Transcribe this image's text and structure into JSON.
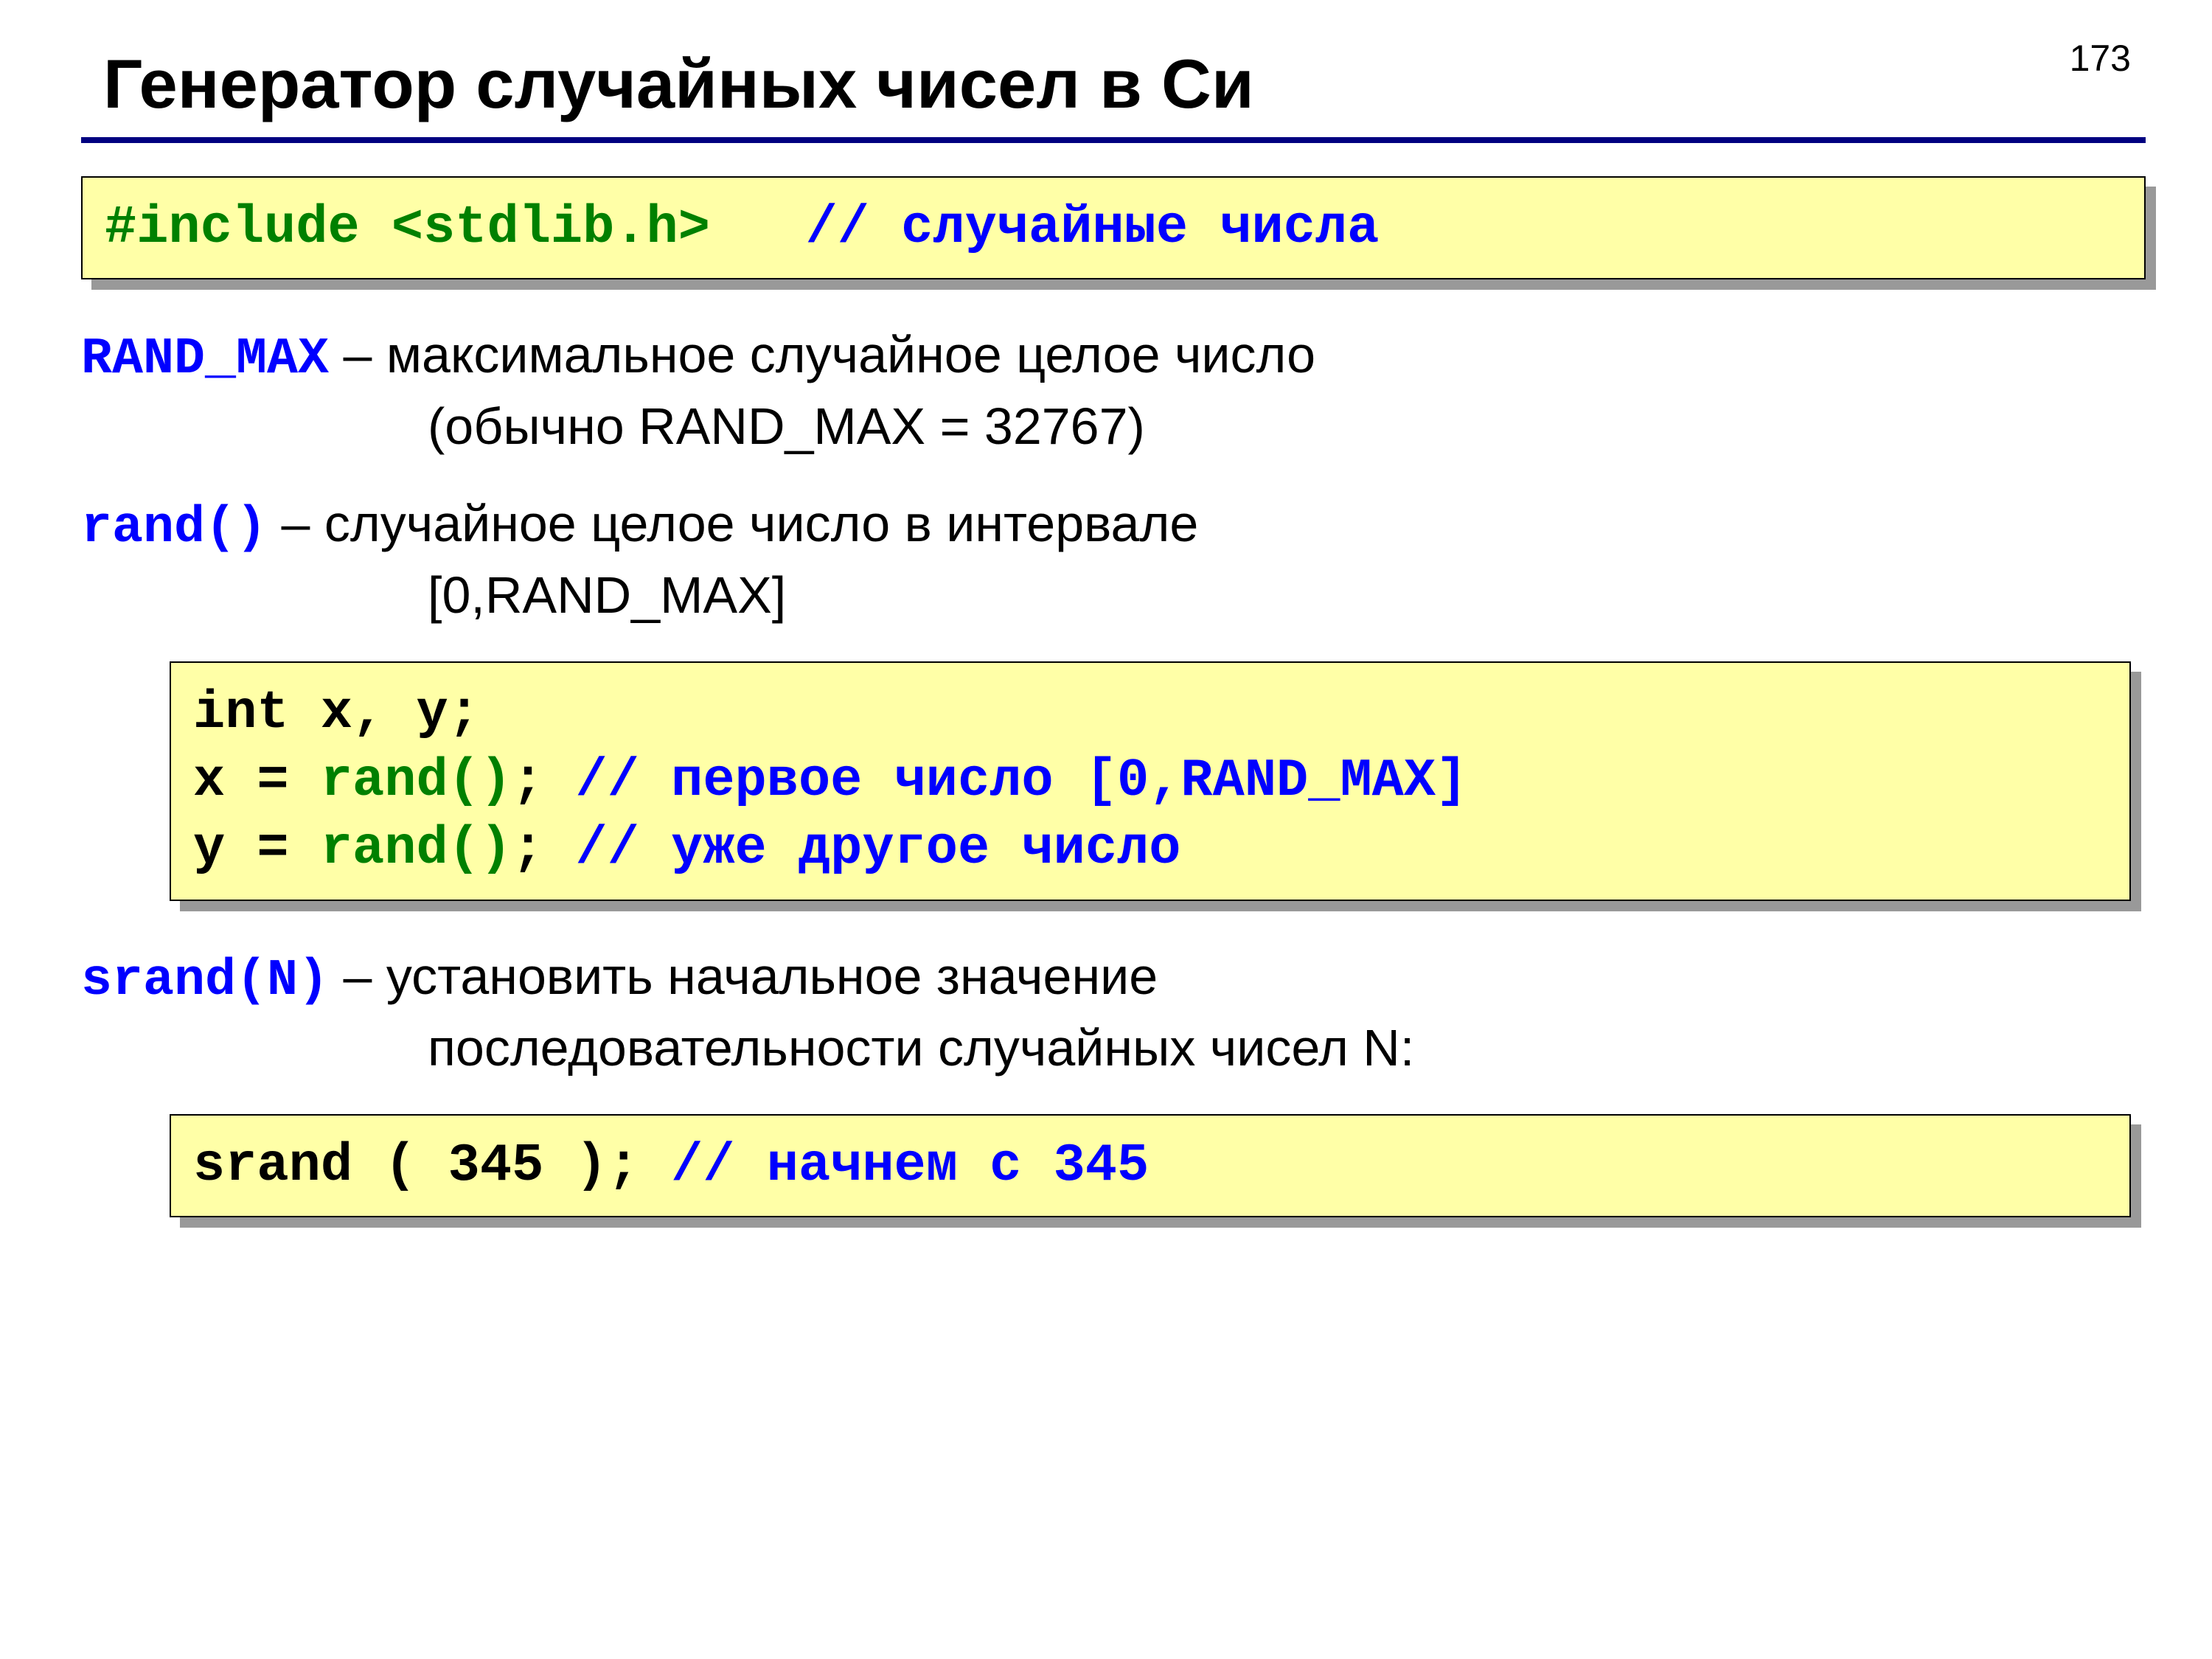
{
  "page_number": "173",
  "title": "Генератор случайных чисел в Си",
  "code1": {
    "directive": "#include <stdlib.h>",
    "spacer": "   ",
    "comment": "// случайные числа"
  },
  "randmax": {
    "kw": "RAND_MAX",
    "desc1": " – максимальное случайное целое число",
    "desc2": "(обычно RAND_MAX = 32767)"
  },
  "randfn": {
    "kw": "rand()",
    "desc1": "  – случайное целое число в интервале",
    "desc2": "[0,RAND_MAX]"
  },
  "code2": {
    "line1_a": "int x, y;",
    "line2_a": "x = ",
    "line2_b": "rand()",
    "line2_c": "; ",
    "line2_d": "// первое число [0,RAND_MAX]",
    "line3_a": "y = ",
    "line3_b": "rand()",
    "line3_c": "; ",
    "line3_d": "// уже другое число"
  },
  "srandfn": {
    "kw": "srand(N)",
    "desc1": " – установить начальное значение",
    "desc2": "последовательности случайных чисел N:"
  },
  "code3": {
    "a": "srand ( 345 ); ",
    "b": "// начнем с 345"
  }
}
